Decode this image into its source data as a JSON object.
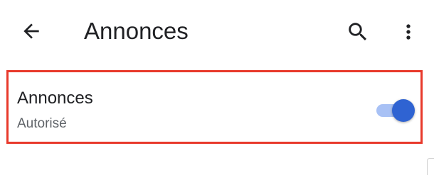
{
  "app_bar": {
    "title": "Annonces",
    "back_icon": "arrow-back-icon",
    "search_icon": "search-icon",
    "more_icon": "more-vert-icon"
  },
  "setting": {
    "label": "Annonces",
    "status": "Autorisé",
    "toggle_on": true
  },
  "colors": {
    "highlight_border": "#e8392b",
    "toggle_thumb": "#2f63d2",
    "toggle_track": "#a8c1f5",
    "text_primary": "#202124",
    "text_secondary": "#5f6368"
  }
}
